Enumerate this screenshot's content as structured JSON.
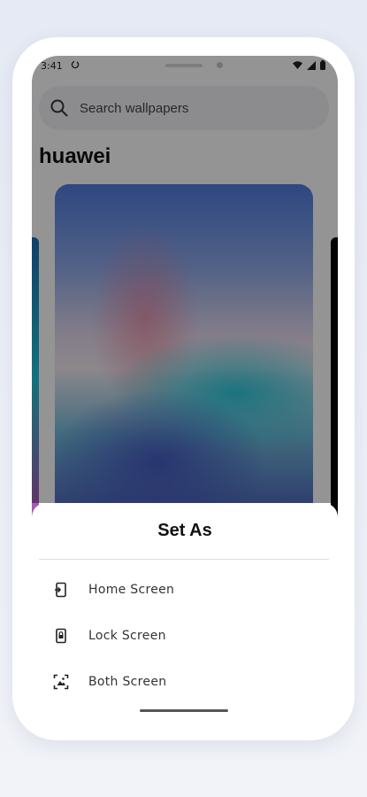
{
  "status_bar": {
    "time": "3:41",
    "sync_icon": "sync-icon",
    "icons": [
      "wifi-icon",
      "signal-icon",
      "battery-icon"
    ]
  },
  "search": {
    "placeholder": "Search wallpapers",
    "icon": "search-icon"
  },
  "gallery": {
    "title": "huawei"
  },
  "sheet": {
    "title": "Set As",
    "options": [
      {
        "label": "Home Screen",
        "icon": "home-screen-icon"
      },
      {
        "label": "Lock Screen",
        "icon": "lock-screen-icon"
      },
      {
        "label": "Both Screen",
        "icon": "both-screen-icon"
      }
    ]
  }
}
